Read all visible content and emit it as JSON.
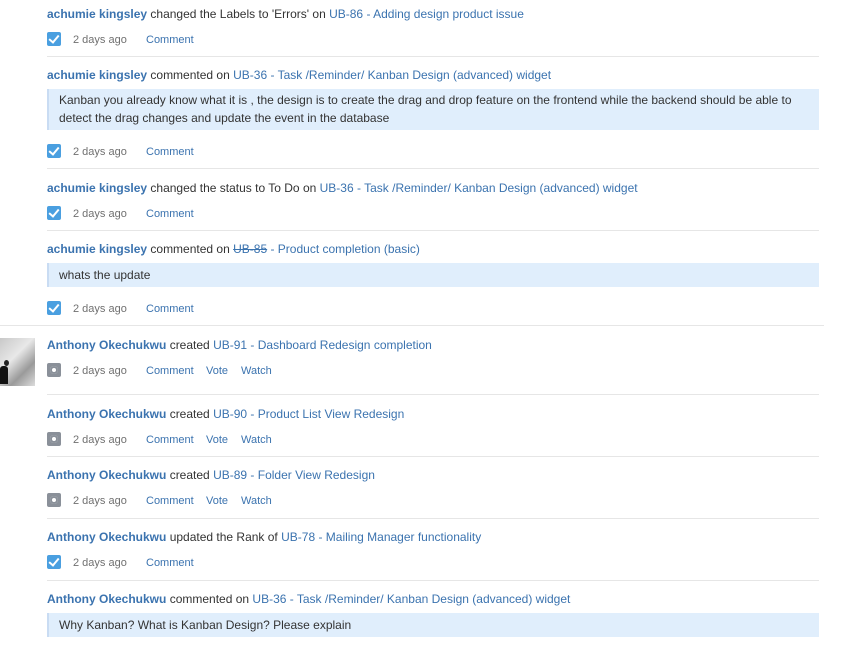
{
  "entries": [
    {
      "user": "achumie kingsley",
      "action": "changed the Labels to 'Errors' on",
      "issue": "UB-86 - Adding design product issue",
      "time": "2 days ago",
      "links": [
        "Comment"
      ]
    },
    {
      "user": "achumie kingsley",
      "action": "commented on",
      "issue": "UB-36 - Task /Reminder/ Kanban Design (advanced) widget",
      "comment": "Kanban you already know what it is , the design is to create the drag and drop feature on the frontend while the backend should be able to detect the drag changes and update the event in the database",
      "time": "2 days ago",
      "links": [
        "Comment"
      ]
    },
    {
      "user": "achumie kingsley",
      "action": "changed the status to To Do on",
      "issue": "UB-36 - Task /Reminder/ Kanban Design (advanced) widget",
      "time": "2 days ago",
      "links": [
        "Comment"
      ]
    },
    {
      "user": "achumie kingsley",
      "action": "commented on",
      "issue_key": "UB-85",
      "issue_title": " - Product completion (basic)",
      "comment": "whats the update",
      "time": "2 days ago",
      "links": [
        "Comment"
      ]
    },
    {
      "user": "Anthony Okechukwu",
      "action": "created",
      "issue": "UB-91 - Dashboard Redesign completion",
      "time": "2 days ago",
      "links": [
        "Comment",
        "Vote",
        "Watch"
      ]
    },
    {
      "user": "Anthony Okechukwu",
      "action": "created",
      "issue": "UB-90 - Product List View Redesign",
      "time": "2 days ago",
      "links": [
        "Comment",
        "Vote",
        "Watch"
      ]
    },
    {
      "user": "Anthony Okechukwu",
      "action": "created",
      "issue": "UB-89 - Folder View Redesign",
      "time": "2 days ago",
      "links": [
        "Comment",
        "Vote",
        "Watch"
      ]
    },
    {
      "user": "Anthony Okechukwu",
      "action": "updated the Rank of",
      "issue": "UB-78 - Mailing Manager functionality",
      "time": "2 days ago",
      "links": [
        "Comment"
      ]
    },
    {
      "user": "Anthony Okechukwu",
      "action": "commented on",
      "issue": "UB-36 - Task /Reminder/ Kanban Design (advanced) widget",
      "comment": "Why Kanban? What is Kanban Design? Please explain"
    }
  ],
  "icons": {
    "task": "checkbox-task-icon",
    "circle": "issue-type-circle-icon",
    "avatar": "user-avatar"
  },
  "colors": {
    "link": "#3b73af",
    "comment_bg": "#e0eefc",
    "task_icon": "#4a9fe0",
    "circle_icon": "#8a9099"
  }
}
